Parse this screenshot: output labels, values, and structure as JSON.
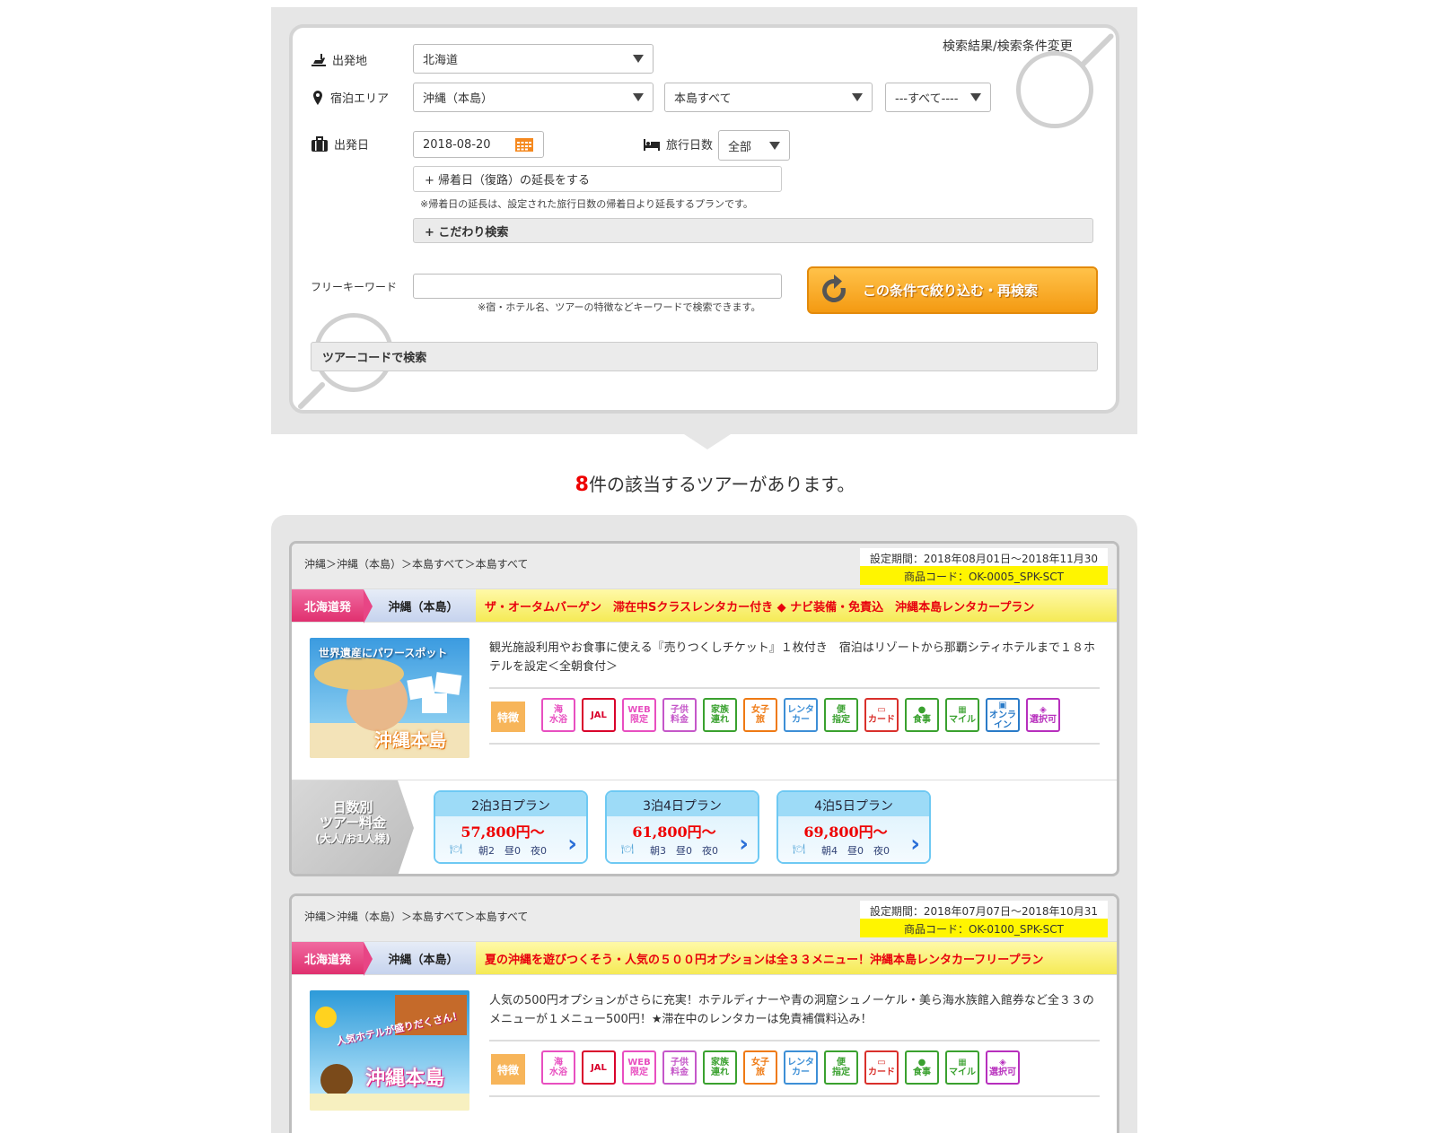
{
  "search": {
    "link": "検索結果/検索条件変更",
    "departure": {
      "label": "出発地",
      "value": "北海道"
    },
    "area": {
      "label": "宿泊エリア",
      "value1": "沖縄（本島）",
      "value2": "本島すべて",
      "value3": "---すべて----"
    },
    "date": {
      "label": "出発日",
      "value": "2018-08-20"
    },
    "days": {
      "label": "旅行日数",
      "value": "全部"
    },
    "extend_button": "+ 帰着日（復路）の延長をする",
    "extend_note": "※帰着日の延長は、設定された旅行日数の帰着日より延長するプランです。",
    "detail_search": "+ こだわり検索",
    "keyword": {
      "label": "フリーキーワード",
      "placeholder": "",
      "note": "※宿・ホテル名、ツアーの特徴などキーワードで検索できます。"
    },
    "submit": "この条件で絞り込む・再検索",
    "tour_code": "ツアーコードで検索"
  },
  "results": {
    "count": "8",
    "text": "件の該当するツアーがあります。"
  },
  "features_label": "特徴",
  "days_label": {
    "line1": "日数別",
    "line2": "ツアー料金",
    "line3": "(大人/お1人様)"
  },
  "tours": [
    {
      "breadcrumb": "沖縄＞沖縄（本島）＞本島すべて＞本島すべて",
      "period": "設定期間：2018年08月01日～2018年11月30",
      "code": "商品コード：OK-0005_SPK-SCT",
      "departure": "北海道発",
      "destination": "沖縄（本島）",
      "title": "ザ・オータムバーゲン　滞在中Sクラスレンタカー付き ◆ ナビ装備・免責込　沖縄本島レンタカープラン",
      "description": "観光施設利用やお食事に使える『売りつくしチケット』１枚付き　宿泊はリゾートから那覇シティホテルまで１８ホテルを設定＜全朝食付＞",
      "thumb_text": "沖縄本島",
      "thumb_sub": "世界遺産にパワースポット",
      "plans": [
        {
          "name": "2泊3日プラン",
          "price": "57,800円～",
          "meals": "朝2　昼0　夜0"
        },
        {
          "name": "3泊4日プラン",
          "price": "61,800円～",
          "meals": "朝3　昼0　夜0"
        },
        {
          "name": "4泊5日プラン",
          "price": "69,800円～",
          "meals": "朝4　昼0　夜0"
        }
      ]
    },
    {
      "breadcrumb": "沖縄＞沖縄（本島）＞本島すべて＞本島すべて",
      "period": "設定期間：2018年07月07日～2018年10月31",
      "code": "商品コード：OK-0100_SPK-SCT",
      "departure": "北海道発",
      "destination": "沖縄（本島）",
      "title": "夏の沖縄を遊びつくそう・人気の５００円オプションは全３３メニュー！沖縄本島レンタカーフリープラン",
      "description": "人気の500円オプションがさらに充実！ホテルディナーや青の洞窟シュノーケル・美ら海水族館入館券など全３３のメニューが１メニュー500円！★滞在中のレンタカーは免責補償料込み！",
      "thumb_text": "沖縄本島",
      "thumb_sub": "人気ホテルが盛りだくさん！"
    }
  ],
  "feature_icons_1": [
    {
      "name": "sea-icon",
      "l1": "海",
      "l2": "水浴",
      "color": "#e84fc0"
    },
    {
      "name": "jal-icon",
      "l1": "JAL",
      "l2": "",
      "color": "#d9002b"
    },
    {
      "name": "web-icon",
      "l1": "WEB",
      "l2": "限定",
      "color": "#e84fc0"
    },
    {
      "name": "child-icon",
      "l1": "子供",
      "l2": "料金",
      "color": "#c557c9"
    },
    {
      "name": "family-icon",
      "l1": "家族",
      "l2": "連れ",
      "color": "#3aa12f"
    },
    {
      "name": "women-icon",
      "l1": "女子",
      "l2": "旅",
      "color": "#ef7a14"
    },
    {
      "name": "rentacar-icon",
      "l1": "レンタ",
      "l2": "カー",
      "color": "#3d8fd6"
    },
    {
      "name": "flight-icon",
      "l1": "便",
      "l2": "指定",
      "color": "#3aa12f"
    },
    {
      "name": "card-icon",
      "l1": "▭",
      "l2": "カード",
      "color": "#d9302b"
    },
    {
      "name": "meal-icon",
      "l1": "●",
      "l2": "食事",
      "color": "#3aa12f"
    },
    {
      "name": "mile-icon",
      "l1": "▦",
      "l2": "マイル",
      "color": "#3aa12f"
    },
    {
      "name": "online-icon",
      "l1": "▣",
      "l2": "オンライン",
      "color": "#2a7bc8"
    },
    {
      "name": "select-icon",
      "l1": "◈",
      "l2": "選択可",
      "color": "#b72fbd"
    }
  ],
  "feature_icons_2": [
    {
      "name": "sea-icon",
      "l1": "海",
      "l2": "水浴",
      "color": "#e84fc0"
    },
    {
      "name": "jal-icon",
      "l1": "JAL",
      "l2": "",
      "color": "#d9002b"
    },
    {
      "name": "web-icon",
      "l1": "WEB",
      "l2": "限定",
      "color": "#e84fc0"
    },
    {
      "name": "child-icon",
      "l1": "子供",
      "l2": "料金",
      "color": "#c557c9"
    },
    {
      "name": "family-icon",
      "l1": "家族",
      "l2": "連れ",
      "color": "#3aa12f"
    },
    {
      "name": "women-icon",
      "l1": "女子",
      "l2": "旅",
      "color": "#ef7a14"
    },
    {
      "name": "rentacar-icon",
      "l1": "レンタ",
      "l2": "カー",
      "color": "#3d8fd6"
    },
    {
      "name": "flight-icon",
      "l1": "便",
      "l2": "指定",
      "color": "#3aa12f"
    },
    {
      "name": "card-icon",
      "l1": "▭",
      "l2": "カード",
      "color": "#d9302b"
    },
    {
      "name": "meal-icon",
      "l1": "●",
      "l2": "食事",
      "color": "#3aa12f"
    },
    {
      "name": "mile-icon",
      "l1": "▦",
      "l2": "マイル",
      "color": "#3aa12f"
    },
    {
      "name": "select-icon",
      "l1": "◈",
      "l2": "選択可",
      "color": "#b72fbd"
    }
  ]
}
